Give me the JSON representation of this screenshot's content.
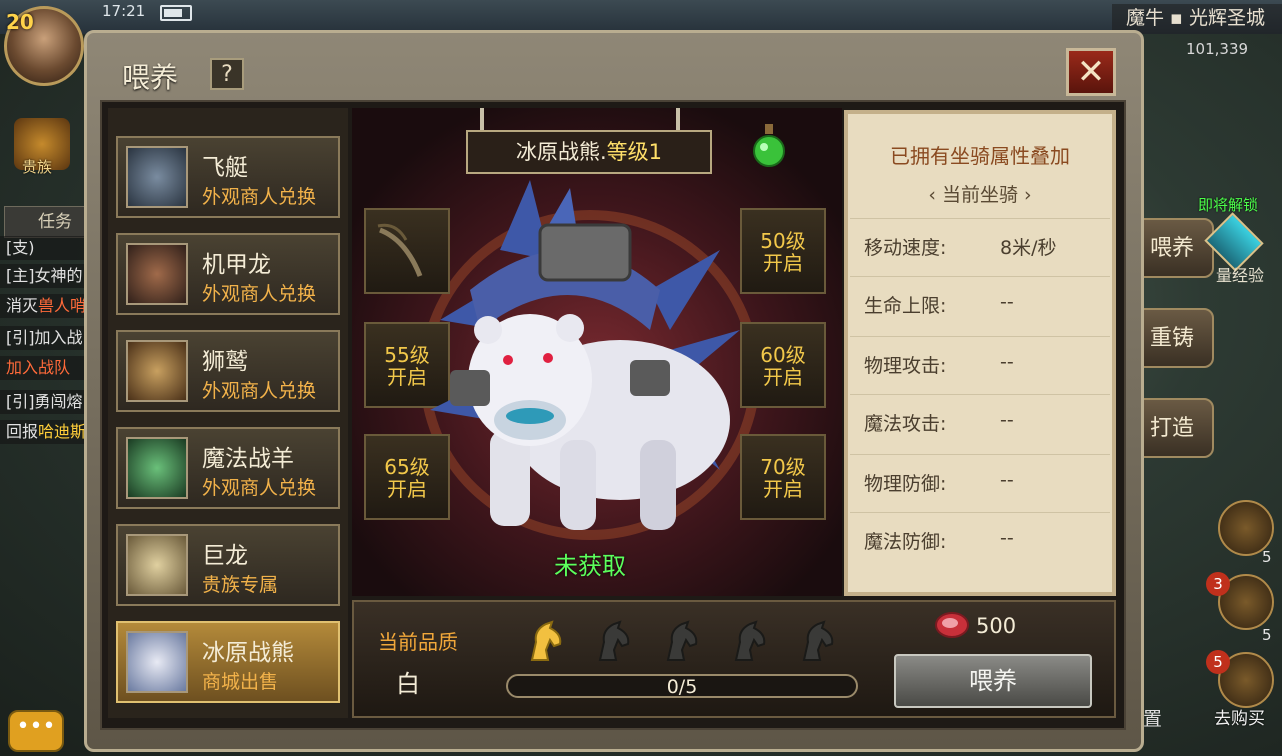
{
  "hud": {
    "player_level": "20",
    "clock": "17:21",
    "location": "魔牛 ▪ 光辉圣城",
    "coords": "101,339",
    "noble_label": "贵族",
    "task_tab": "任务",
    "quest_lines": [
      {
        "prefix": "[支)",
        "highlight": ""
      },
      {
        "prefix": "[主]女神的",
        "highlight": ""
      },
      {
        "prefix": "消灭",
        "highlight": "兽人哨"
      },
      {
        "prefix": "[引]加入战",
        "highlight": ""
      },
      {
        "prefix": "",
        "highlight": "加入战队"
      },
      {
        "prefix": "[引]勇闯熔",
        "highlight": ""
      },
      {
        "prefix": "回报",
        "highlight": "哈迪斯"
      }
    ],
    "right_buttons": [
      "喂养",
      "重铸",
      "打造"
    ],
    "unlock_tag": "即将解锁",
    "exp_tag": "量经验",
    "side_counts": [
      "5",
      "5"
    ],
    "badges": [
      "3",
      "5"
    ],
    "buy_label": "去购买",
    "setting_label": "设置",
    "chat_label": "•••"
  },
  "dialog": {
    "title": "喂养",
    "help": "?",
    "close": "✕"
  },
  "mounts": [
    {
      "name": "飞艇",
      "source": "外观商人兑换",
      "selected": false
    },
    {
      "name": "机甲龙",
      "source": "外观商人兑换",
      "selected": false
    },
    {
      "name": "狮鹫",
      "source": "外观商人兑换",
      "selected": false
    },
    {
      "name": "魔法战羊",
      "source": "外观商人兑换",
      "selected": false
    },
    {
      "name": "巨龙",
      "source": "贵族专属",
      "selected": false
    },
    {
      "name": "冰原战熊",
      "source": "商城出售",
      "selected": true
    }
  ],
  "showcase": {
    "mount_name": "冰原战熊.",
    "mount_level": "等级1",
    "status": "未获取",
    "slots": [
      {
        "label": "",
        "unlocked": true
      },
      {
        "label": "50级\n开启"
      },
      {
        "label": "55级\n开启"
      },
      {
        "label": "60级\n开启"
      },
      {
        "label": "65级\n开启"
      },
      {
        "label": "70级\n开启"
      }
    ]
  },
  "attributes": {
    "heading": "已拥有坐骑属性叠加",
    "subheading": "‹ 当前坐骑 ›",
    "rows": [
      {
        "label": "移动速度:",
        "value": "8米/秒"
      },
      {
        "label": "生命上限:",
        "value": "--"
      },
      {
        "label": "物理攻击:",
        "value": "--"
      },
      {
        "label": "魔法攻击:",
        "value": "--"
      },
      {
        "label": "物理防御:",
        "value": "--"
      },
      {
        "label": "魔法防御:",
        "value": "--"
      }
    ]
  },
  "feed": {
    "quality_label": "当前品质",
    "quality_value": "白",
    "stars_filled": 1,
    "stars_total": 5,
    "progress_text": "0/5",
    "progress_fraction": 0,
    "cost": "500",
    "button": "喂养"
  },
  "colors": {
    "accent_gold": "#f2a83a",
    "status_green": "#5cff5c",
    "level_yellow": "#ffe06a"
  }
}
